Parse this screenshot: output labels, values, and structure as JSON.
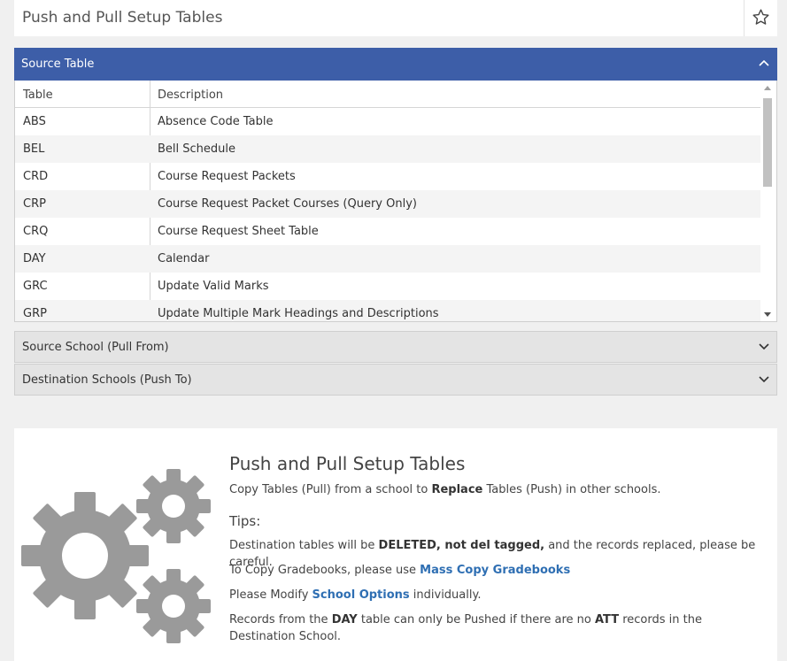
{
  "header": {
    "title": "Push and Pull Setup Tables",
    "star_icon": "star-icon"
  },
  "source_table": {
    "label": "Source Table",
    "columns": [
      "Table",
      "Description"
    ],
    "rows": [
      {
        "code": "ABS",
        "desc": "Absence Code Table"
      },
      {
        "code": "BEL",
        "desc": "Bell Schedule"
      },
      {
        "code": "CRD",
        "desc": "Course Request Packets"
      },
      {
        "code": "CRP",
        "desc": "Course Request Packet Courses (Query Only)"
      },
      {
        "code": "CRQ",
        "desc": "Course Request Sheet Table"
      },
      {
        "code": "DAY",
        "desc": "Calendar"
      },
      {
        "code": "GRC",
        "desc": "Update Valid Marks"
      },
      {
        "code": "GRP",
        "desc": "Update Multiple Mark Headings and Descriptions"
      }
    ]
  },
  "sections": {
    "source_school": "Source School (Pull From)",
    "destination_schools": "Destination Schools (Push To)"
  },
  "info": {
    "title": "Push and Pull Setup Tables",
    "line1_a": "Copy Tables (Pull) from a school to ",
    "line1_b": "Replace",
    "line1_c": " Tables (Push) in other schools.",
    "tips_label": "Tips:",
    "tip1_a": "Destination tables will be ",
    "tip1_b": "DELETED, not del tagged,",
    "tip1_c": " and the records replaced, please be careful.",
    "tip2_a": "To Copy Gradebooks, please use ",
    "tip2_link": "Mass Copy Gradebooks",
    "tip3_a": "Please Modify ",
    "tip3_link": "School Options",
    "tip3_c": " individually.",
    "tip4_a": "Records from the ",
    "tip4_b": "DAY",
    "tip4_c": " table can only be Pushed if there are no ",
    "tip4_d": "ATT",
    "tip4_e": " records in the Destination School."
  },
  "colors": {
    "accent": "#3d5ea8",
    "link": "#2f6fb3",
    "gear": "#9a9a9a"
  }
}
